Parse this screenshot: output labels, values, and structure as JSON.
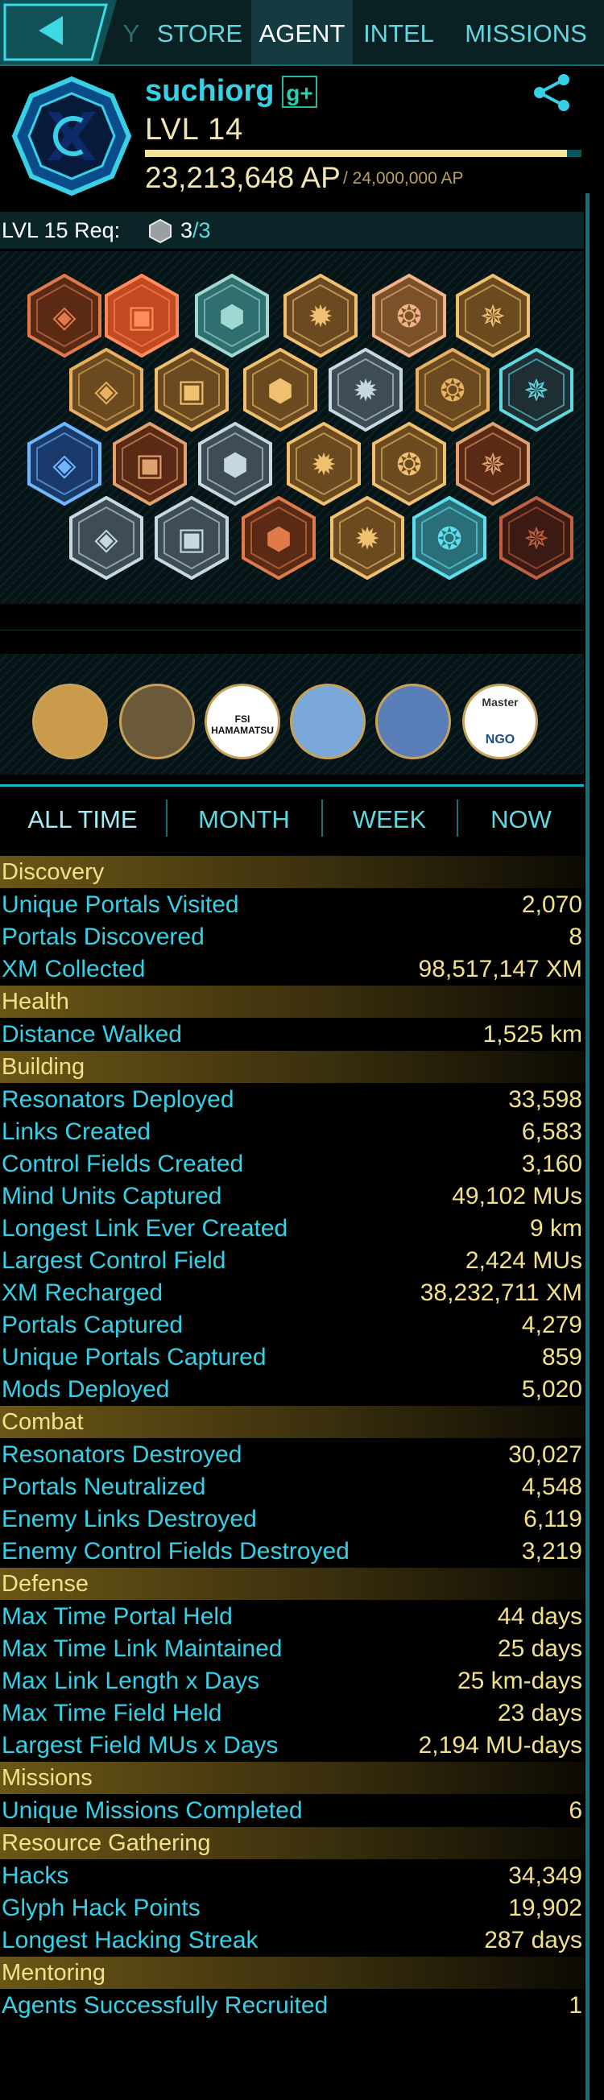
{
  "nav": {
    "partial_tab": "Y",
    "tabs": [
      "STORE",
      "AGENT",
      "INTEL",
      "MISSIONS"
    ],
    "active": "AGENT"
  },
  "agent": {
    "name": "suchiorg",
    "gplus": "g+",
    "level": "LVL 14",
    "ap": "23,213,648 AP",
    "ap_max": "/ 24,000,000 AP",
    "ap_progress": 0.967,
    "req_label": "LVL 15 Req:",
    "req_have": "3",
    "req_total": "/3"
  },
  "missions": [
    {
      "label": ""
    },
    {
      "label": ""
    },
    {
      "label": "FSI HAMAMATSU"
    },
    {
      "label": ""
    },
    {
      "label": ""
    },
    {
      "label": "Master",
      "sub": "NGO"
    }
  ],
  "time_tabs": [
    "ALL TIME",
    "MONTH",
    "WEEK",
    "NOW"
  ],
  "colors": {
    "accent": "#37d0e6",
    "gold": "#f3e08a",
    "bg": "#000000"
  },
  "sections": [
    {
      "title": "Discovery",
      "rows": [
        [
          "Unique Portals Visited",
          "2,070"
        ],
        [
          "Portals Discovered",
          "8"
        ],
        [
          "XM Collected",
          "98,517,147 XM"
        ]
      ]
    },
    {
      "title": "Health",
      "rows": [
        [
          "Distance Walked",
          "1,525 km"
        ]
      ]
    },
    {
      "title": "Building",
      "rows": [
        [
          "Resonators Deployed",
          "33,598"
        ],
        [
          "Links Created",
          "6,583"
        ],
        [
          "Control Fields Created",
          "3,160"
        ],
        [
          "Mind Units Captured",
          "49,102 MUs"
        ],
        [
          "Longest Link Ever Created",
          "9 km"
        ],
        [
          "Largest Control Field",
          "2,424 MUs"
        ],
        [
          "XM Recharged",
          "38,232,711 XM"
        ],
        [
          "Portals Captured",
          "4,279"
        ],
        [
          "Unique Portals Captured",
          "859"
        ],
        [
          "Mods Deployed",
          "5,020"
        ]
      ]
    },
    {
      "title": "Combat",
      "rows": [
        [
          "Resonators Destroyed",
          "30,027"
        ],
        [
          "Portals Neutralized",
          "4,548"
        ],
        [
          "Enemy Links Destroyed",
          "6,119"
        ],
        [
          "Enemy Control Fields Destroyed",
          "3,219"
        ]
      ]
    },
    {
      "title": "Defense",
      "rows": [
        [
          "Max Time Portal Held",
          "44 days"
        ],
        [
          "Max Time Link Maintained",
          "25 days"
        ],
        [
          "Max Link Length x Days",
          "25 km-days"
        ],
        [
          "Max Time Field Held",
          "23 days"
        ],
        [
          "Largest Field MUs x Days",
          "2,194 MU-days"
        ]
      ]
    },
    {
      "title": "Missions",
      "rows": [
        [
          "Unique Missions Completed",
          "6"
        ]
      ]
    },
    {
      "title": "Resource Gathering",
      "rows": [
        [
          "Hacks",
          "34,349"
        ],
        [
          "Glyph Hack Points",
          "19,902"
        ],
        [
          "Longest Hacking Streak",
          "287 days"
        ]
      ]
    },
    {
      "title": "Mentoring",
      "rows": [
        [
          "Agents Successfully Recruited",
          "1"
        ]
      ]
    }
  ]
}
